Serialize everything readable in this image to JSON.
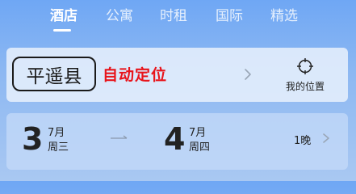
{
  "tabs": [
    {
      "label": "酒店",
      "active": true
    },
    {
      "label": "公寓",
      "active": false
    },
    {
      "label": "时租",
      "active": false
    },
    {
      "label": "国际",
      "active": false
    },
    {
      "label": "精选",
      "active": false
    }
  ],
  "location": {
    "city": "平遥县",
    "auto_locate_label": "自动定位",
    "my_location_label": "我的位置"
  },
  "dates": {
    "checkin": {
      "day": "3",
      "month": "7月",
      "weekday": "周三"
    },
    "checkout": {
      "day": "4",
      "month": "7月",
      "weekday": "周四"
    },
    "nights": "1晚"
  },
  "colors": {
    "background_top": "#6fa7f4",
    "accent_red": "#e8141b"
  }
}
